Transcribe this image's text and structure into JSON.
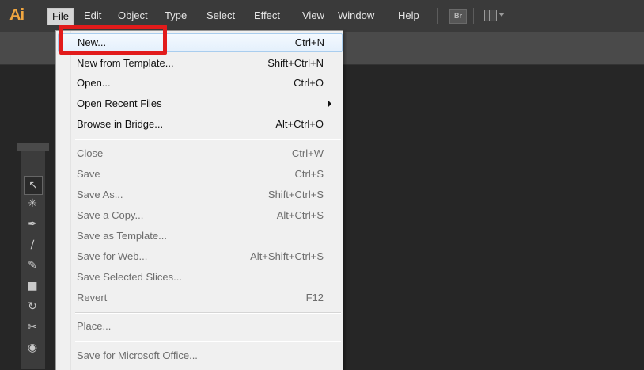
{
  "app": {
    "logo": "Ai"
  },
  "menubar": {
    "items": [
      "File",
      "Edit",
      "Object",
      "Type",
      "Select",
      "Effect",
      "View",
      "Window",
      "Help"
    ],
    "bridge_button": "Br"
  },
  "file_menu": {
    "items": [
      {
        "label": "New...",
        "shortcut": "Ctrl+N"
      },
      {
        "label": "New from Template...",
        "shortcut": "Shift+Ctrl+N"
      },
      {
        "label": "Open...",
        "shortcut": "Ctrl+O"
      },
      {
        "label": "Open Recent Files",
        "shortcut": ""
      },
      {
        "label": "Browse in Bridge...",
        "shortcut": "Alt+Ctrl+O"
      },
      {
        "label": "Close",
        "shortcut": "Ctrl+W"
      },
      {
        "label": "Save",
        "shortcut": "Ctrl+S"
      },
      {
        "label": "Save As...",
        "shortcut": "Shift+Ctrl+S"
      },
      {
        "label": "Save a Copy...",
        "shortcut": "Alt+Ctrl+S"
      },
      {
        "label": "Save as Template...",
        "shortcut": ""
      },
      {
        "label": "Save for Web...",
        "shortcut": "Alt+Shift+Ctrl+S"
      },
      {
        "label": "Save Selected Slices...",
        "shortcut": ""
      },
      {
        "label": "Revert",
        "shortcut": "F12"
      },
      {
        "label": "Place...",
        "shortcut": ""
      },
      {
        "label": "Save for Microsoft Office...",
        "shortcut": ""
      }
    ]
  },
  "tools": [
    "selection-tool",
    "magic-wand-tool",
    "pen-tool",
    "line-tool",
    "paintbrush-tool",
    "blob-brush-tool",
    "rotate-tool",
    "scissors-tool",
    "globe-tool"
  ],
  "colors": {
    "highlight_box": "#e21b1b",
    "logo": "#f0a640",
    "menu_bg": "#f0f0f0"
  }
}
